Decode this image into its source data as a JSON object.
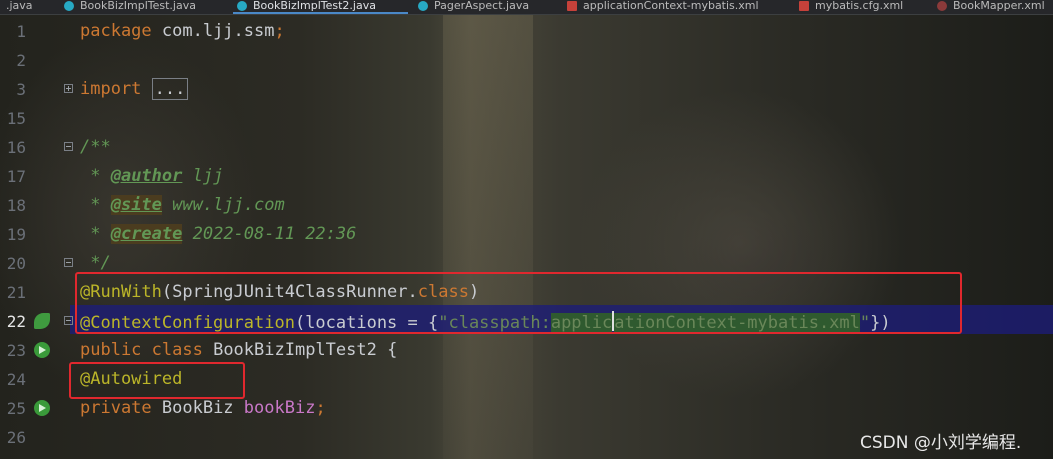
{
  "tabs": [
    {
      "label": ".java",
      "icon": "java-file-icon",
      "active": false
    },
    {
      "label": "BookBizImplTest.java",
      "icon": "java-file-icon",
      "active": false
    },
    {
      "label": "BookBizImplTest2.java",
      "icon": "java-file-icon",
      "active": true
    },
    {
      "label": "PagerAspect.java",
      "icon": "java-file-icon",
      "active": false
    },
    {
      "label": "applicationContext-mybatis.xml",
      "icon": "xml-file-icon",
      "active": false
    },
    {
      "label": "mybatis.cfg.xml",
      "icon": "xml-file-icon",
      "active": false
    },
    {
      "label": "BookMapper.xml",
      "icon": "mapper-file-icon",
      "active": false
    }
  ],
  "lines": {
    "l1": {
      "num": "1",
      "package_kw": "package",
      "package_name": " com.ljj.ssm",
      "semi": ";"
    },
    "l2": {
      "num": "2"
    },
    "l3": {
      "num": "3",
      "import_kw": "import",
      "folded": "..."
    },
    "l15": {
      "num": "15"
    },
    "l16": {
      "num": "16",
      "text": "/**"
    },
    "l17": {
      "num": "17",
      "prefix": " * ",
      "tag": "@author",
      "value": " ljj"
    },
    "l18": {
      "num": "18",
      "prefix": " * ",
      "tag": "@site",
      "value": " www.ljj.com"
    },
    "l19": {
      "num": "19",
      "prefix": " * ",
      "tag": "@create",
      "value": " 2022-08-11 22:36"
    },
    "l20": {
      "num": "20",
      "text": " */"
    },
    "l21": {
      "num": "21",
      "ann": "@RunWith",
      "open": "(SpringJUnit4ClassRunner.",
      "kw": "class",
      "close": ")"
    },
    "l22": {
      "num": "22",
      "ann": "@ContextConfiguration",
      "mid": "(locations = {",
      "str_a": "\"classpath:",
      "str_b": "applic",
      "str_c": "ationContext-mybatis.xml",
      "str_d": "\"",
      "close": "})"
    },
    "l23": {
      "num": "23",
      "kw1": "public",
      "kw2": " class",
      "name": " BookBizImplTest2 {"
    },
    "l24": {
      "num": "24",
      "ann": "@Autowired"
    },
    "l25": {
      "num": "25",
      "kw": "private",
      "type": " BookBiz ",
      "field": "bookBiz",
      "semi": ";"
    },
    "l26": {
      "num": "26"
    }
  },
  "watermark": "CSDN @小刘学编程."
}
